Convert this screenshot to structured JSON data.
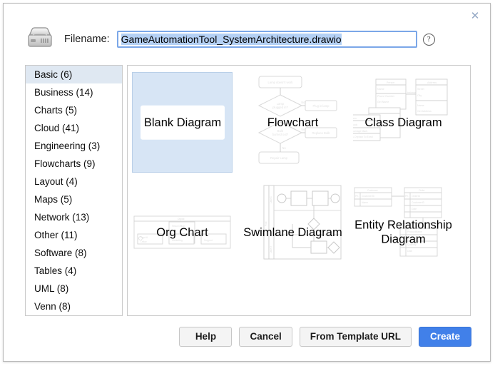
{
  "dialog": {
    "close_label": "✕",
    "filename_label": "Filename:",
    "filename_value": "GameAutomationTool_SystemArchitecture.drawio",
    "filename_placeholder": "Filename",
    "help_icon_label": "?",
    "disk_icon": "hard-disk-icon"
  },
  "categories": {
    "selected": "Basic (6)",
    "items": [
      {
        "label": "Basic (6)",
        "name": "Basic",
        "count": 6
      },
      {
        "label": "Business (14)",
        "name": "Business",
        "count": 14
      },
      {
        "label": "Charts (5)",
        "name": "Charts",
        "count": 5
      },
      {
        "label": "Cloud (41)",
        "name": "Cloud",
        "count": 41
      },
      {
        "label": "Engineering (3)",
        "name": "Engineering",
        "count": 3
      },
      {
        "label": "Flowcharts (9)",
        "name": "Flowcharts",
        "count": 9
      },
      {
        "label": "Layout (4)",
        "name": "Layout",
        "count": 4
      },
      {
        "label": "Maps (5)",
        "name": "Maps",
        "count": 5
      },
      {
        "label": "Network (13)",
        "name": "Network",
        "count": 13
      },
      {
        "label": "Other (11)",
        "name": "Other",
        "count": 11
      },
      {
        "label": "Software (8)",
        "name": "Software",
        "count": 8
      },
      {
        "label": "Tables (4)",
        "name": "Tables",
        "count": 4
      },
      {
        "label": "UML (8)",
        "name": "UML",
        "count": 8
      },
      {
        "label": "Venn (8)",
        "name": "Venn",
        "count": 8
      }
    ]
  },
  "templates": {
    "selected": "Blank Diagram",
    "items": [
      {
        "label": "Blank Diagram",
        "thumb": "blank"
      },
      {
        "label": "Flowchart",
        "thumb": "flowchart"
      },
      {
        "label": "Class Diagram",
        "thumb": "class"
      },
      {
        "label": "Org Chart",
        "thumb": "orgchart"
      },
      {
        "label": "Swimlane Diagram",
        "thumb": "swimlane"
      },
      {
        "label": "Entity Relationship Diagram",
        "thumb": "erd"
      }
    ],
    "thumb_text": {
      "flowchart": [
        "Lamp doesn't work",
        "Lamp plugged in?",
        "Plug in lamp",
        "No",
        "Bulb burned out?",
        "Replace Bulb",
        "Yes",
        "No",
        "Repair Lamp"
      ],
      "class": [
        "Person",
        "Address",
        "belongs"
      ],
      "orgchart": [
        "Digital"
      ],
      "swimlane": [
        "Pool",
        "Lane 1",
        "Lane 2",
        "Lane 3"
      ],
      "erd": [
        "Customer",
        "Order",
        "PK",
        "CustomerID",
        "Name",
        "PK OrderID",
        "CustomerID",
        "Date"
      ]
    }
  },
  "footer": {
    "help_label": "Help",
    "cancel_label": "Cancel",
    "from_template_url_label": "From Template URL",
    "create_label": "Create"
  },
  "colors": {
    "accent": "#4180e9",
    "selection_blue": "#d7e5f5",
    "list_selection": "#dfe8f2",
    "input_border": "#7ba7e8",
    "text_selection": "#b4d0f4"
  }
}
